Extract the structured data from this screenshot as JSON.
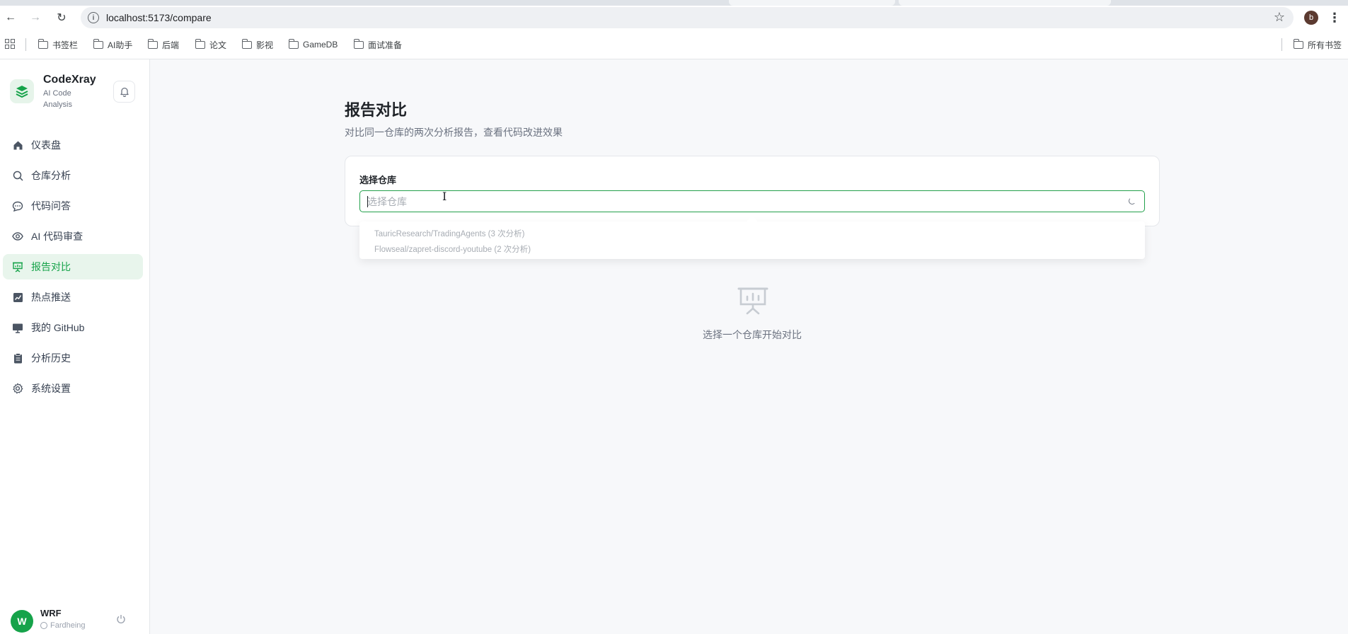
{
  "browser": {
    "url": "localhost:5173/compare",
    "profile_initial": "b",
    "bookmarks": [
      "书签栏",
      "AI助手",
      "后端",
      "论文",
      "影视",
      "GameDB",
      "面试准备"
    ],
    "all_bookmarks": "所有书签"
  },
  "sidebar": {
    "brand_name": "CodeXray",
    "brand_sub": "AI Code Analysis",
    "items": [
      {
        "label": "仪表盘",
        "icon": "home-icon"
      },
      {
        "label": "仓库分析",
        "icon": "search-icon"
      },
      {
        "label": "代码问答",
        "icon": "chat-icon"
      },
      {
        "label": "AI 代码审查",
        "icon": "eye-icon"
      },
      {
        "label": "报告对比",
        "icon": "presentation-icon"
      },
      {
        "label": "热点推送",
        "icon": "trend-icon"
      },
      {
        "label": "我的 GitHub",
        "icon": "monitor-icon"
      },
      {
        "label": "分析历史",
        "icon": "clipboard-icon"
      },
      {
        "label": "系统设置",
        "icon": "gear-icon"
      }
    ],
    "active_item": "报告对比",
    "user": {
      "initial": "W",
      "name": "WRF",
      "org": "Fardheing"
    }
  },
  "main": {
    "title": "报告对比",
    "description": "对比同一仓库的两次分析报告，查看代码改进效果",
    "field_label": "选择仓库",
    "select_placeholder": "选择仓库",
    "options": [
      "TauricResearch/TradingAgents (3 次分析)",
      "Flowseal/zapret-discord-youtube (2 次分析)"
    ],
    "empty_text": "选择一个仓库开始对比"
  },
  "colors": {
    "accent": "#16a34a",
    "accent_bg": "#e8f5ec"
  }
}
